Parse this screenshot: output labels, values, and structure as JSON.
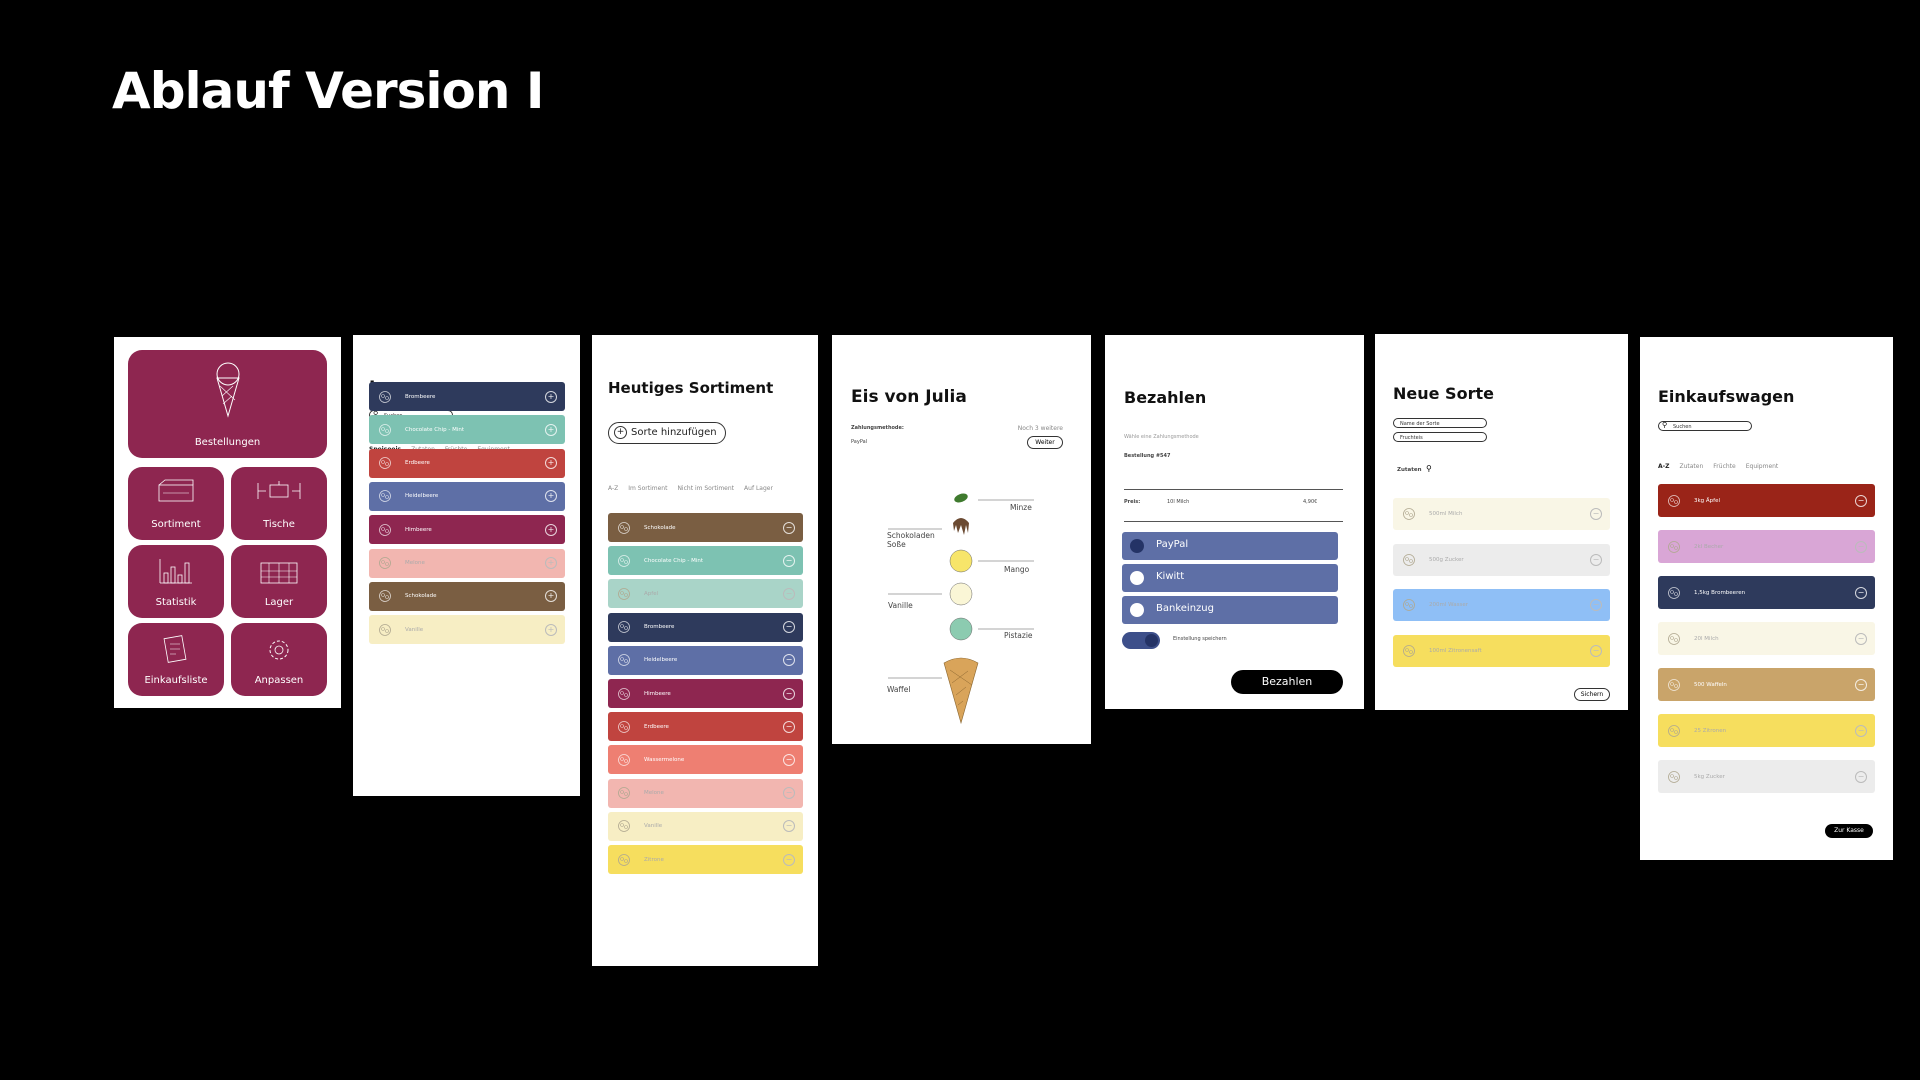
{
  "page_title": "Ablauf Version I",
  "screen1": {
    "tiles": [
      {
        "label": "Bestellungen",
        "icon": "ice-cream-cone-icon"
      },
      {
        "label": "Sortiment",
        "icon": "display-case-icon"
      },
      {
        "label": "Tische",
        "icon": "table-chairs-icon"
      },
      {
        "label": "Statistik",
        "icon": "bar-chart-icon"
      },
      {
        "label": "Lager",
        "icon": "warehouse-icon"
      },
      {
        "label": "Einkaufsliste",
        "icon": "shopping-list-icon"
      },
      {
        "label": "Anpassen",
        "icon": "gear-icon"
      }
    ]
  },
  "screen2": {
    "title": "Lager",
    "search_placeholder": "Suchen",
    "tabs": [
      "Speiseeis",
      "Zutaten",
      "Früchte",
      "Equipment"
    ],
    "items": [
      {
        "label": "Brombeere",
        "color": "#2e3a5c",
        "icon": "blackberry-icon"
      },
      {
        "label": "Chocolate Chip - Mint",
        "color": "#7dc2b2",
        "icon": "mint-leaf-icon"
      },
      {
        "label": "Erdbeere",
        "color": "#c0443f",
        "icon": "strawberry-icon"
      },
      {
        "label": "Heidelbeere",
        "color": "#5e6fa6",
        "icon": "blueberry-icon"
      },
      {
        "label": "Himbeere",
        "color": "#8e2650",
        "icon": "raspberry-icon"
      },
      {
        "label": "Melone",
        "color": "#f2b6b0",
        "icon": "melon-icon"
      },
      {
        "label": "Schokolade",
        "color": "#7a5e42",
        "icon": "chocolate-icon"
      },
      {
        "label": "Vanille",
        "color": "#f7eec4",
        "icon": "vanilla-icon"
      }
    ]
  },
  "screen3": {
    "title": "Heutiges Sortiment",
    "add_button": "Sorte hinzufügen",
    "tabs": [
      "A-Z",
      "Im Sortiment",
      "Nicht im Sortiment",
      "Auf Lager"
    ],
    "items": [
      {
        "label": "Schokolade",
        "color": "#7a5e42",
        "icon": "chocolate-icon"
      },
      {
        "label": "Chocolate Chip - Mint",
        "color": "#7dc2b2",
        "icon": "mint-leaf-icon"
      },
      {
        "label": "Apfel",
        "color": "#a9d4c8",
        "icon": "apple-icon"
      },
      {
        "label": "Brombeere",
        "color": "#2e3a5c",
        "icon": "blackberry-icon"
      },
      {
        "label": "Heidelbeere",
        "color": "#5e6fa6",
        "icon": "blueberry-icon"
      },
      {
        "label": "Himbeere",
        "color": "#8e2650",
        "icon": "raspberry-icon"
      },
      {
        "label": "Erdbeere",
        "color": "#c0443f",
        "icon": "strawberry-icon"
      },
      {
        "label": "Wassermelone",
        "color": "#ee7f72",
        "icon": "watermelon-icon"
      },
      {
        "label": "Melone",
        "color": "#f2b6b0",
        "icon": "melon-icon"
      },
      {
        "label": "Vanille",
        "color": "#f7eec4",
        "icon": "vanilla-icon"
      },
      {
        "label": "Zitrone",
        "color": "#f6de5e",
        "icon": "lemon-icon"
      }
    ]
  },
  "screen4": {
    "title": "Eis von Julia",
    "payment_label": "Zahlungsmethode:",
    "payment_value": "PayPal",
    "more_text": "Noch 3 weitere",
    "next_button": "Weiter",
    "labels": {
      "minze": "Minze",
      "sosse": "Schokoladen Soße",
      "mango": "Mango",
      "vanille": "Vanille",
      "pistazie": "Pistazie",
      "waffel": "Waffel"
    }
  },
  "screen5": {
    "title": "Bezahlen",
    "hint": "Wähle eine Zahlungsmethode",
    "order": "Bestellung #547",
    "price_label": "Preis:",
    "price_item": "10l Milch",
    "price_value": "4,90€",
    "methods": [
      "PayPal",
      "Kiwitt",
      "Bankeinzug"
    ],
    "toggle_label": "Einstellung speichern",
    "pay_button": "Bezahlen",
    "method_color": "#5e6fa6"
  },
  "screen6": {
    "title": "Neue Sorte",
    "field_name": "Name der Sorte",
    "field_fruit": "Fruchteis",
    "ingredients_label": "Zutaten",
    "items": [
      {
        "label": "500ml Milch",
        "color": "#f9f6e6",
        "icon": "milk-icon"
      },
      {
        "label": "500g Zucker",
        "color": "#ececec",
        "icon": "sugar-icon"
      },
      {
        "label": "200ml Wasser",
        "color": "#8fbff6",
        "icon": "water-icon"
      },
      {
        "label": "100ml Zitronensaft",
        "color": "#f6de5e",
        "icon": "lemon-icon"
      }
    ],
    "save_button": "Sichern"
  },
  "screen7": {
    "title": "Einkaufswagen",
    "search_placeholder": "Suchen",
    "tabs": [
      "A-Z",
      "Zutaten",
      "Früchte",
      "Equipment"
    ],
    "items": [
      {
        "label": "3kg Äpfel",
        "color": "#9a2418",
        "icon": "apple-icon"
      },
      {
        "label": "2kl Becher",
        "color": "#d9a6d6",
        "icon": "cup-icon"
      },
      {
        "label": "1,5kg Brombeeren",
        "color": "#2e3a5c",
        "icon": "blackberry-icon"
      },
      {
        "label": "20l Milch",
        "color": "#f9f6e6",
        "icon": "milk-icon"
      },
      {
        "label": "500 Waffeln",
        "color": "#c9a46a",
        "icon": "waffle-icon"
      },
      {
        "label": "25 Zitronen",
        "color": "#f6de5e",
        "icon": "lemon-icon"
      },
      {
        "label": "5kg Zucker",
        "color": "#ececec",
        "icon": "sugar-icon"
      }
    ],
    "checkout_button": "Zur Kasse"
  }
}
